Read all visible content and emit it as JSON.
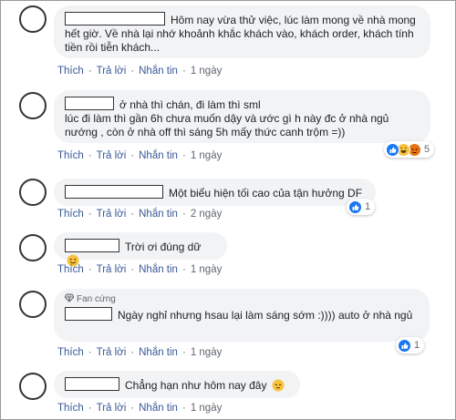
{
  "actions": {
    "like": "Thích",
    "reply": "Trả lời",
    "message": "Nhắn tin",
    "separator": "·"
  },
  "comments": [
    {
      "text": "Hôm nay vừa thử việc, lúc làm mong về nhà mong hết giờ. Về nhà lại nhớ khoảnh khắc khách vào, khách order, khách tính tiền rồi tiễn khách...",
      "time": "1 ngày"
    },
    {
      "text": "ở nhà thì chán, đi làm thì sml\nlúc đi làm thì gần 6h chưa muốn dậy và ước gì h này đc ở nhà ngủ nướng , còn ở nhà off thì sáng 5h mấy thức canh trộm =))",
      "time": "1 ngày",
      "reactions": {
        "count": "5",
        "icons": [
          "like-reaction-icon",
          "haha-reaction-icon",
          "angry-reaction-icon"
        ]
      }
    },
    {
      "text": "Một biểu hiện tối cao của tận hưởng DF",
      "time": "2 ngày",
      "reactions": {
        "count": "1",
        "icons": [
          "like-reaction-icon"
        ]
      }
    },
    {
      "text": "Trời ơi đúng dữ",
      "time": "1 ngày",
      "emoji": "smile-emoji-icon"
    },
    {
      "badge": "Fan cứng",
      "text": "Ngày nghỉ nhưng hsau lại làm sáng sớm :)))) auto ở nhà ngủ",
      "time": "1 ngày",
      "reactions": {
        "count": "1",
        "icons": [
          "like-reaction-icon"
        ]
      }
    },
    {
      "text": "Chẳng hạn như hôm nay đây",
      "time": "1 ngày",
      "emoji": "pensive-emoji-icon"
    }
  ]
}
